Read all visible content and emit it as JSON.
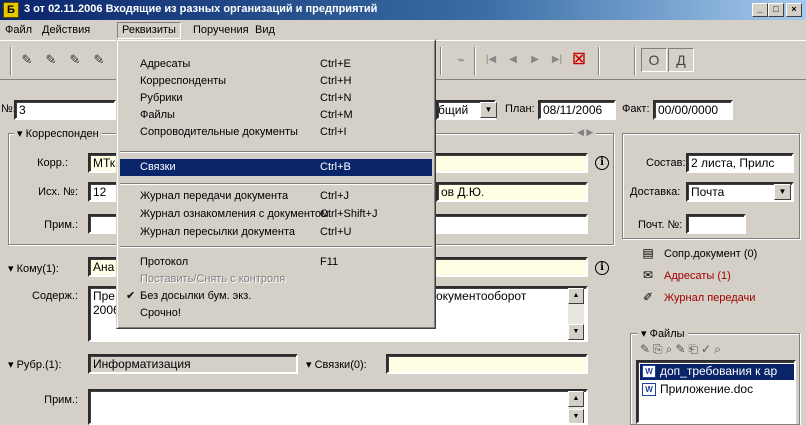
{
  "window": {
    "app_icon": "Б",
    "title": "3 от 02.11.2006 Входящие из разных организаций и предприятий",
    "controls": {
      "minimize": "_",
      "maximize": "□",
      "close": "×"
    }
  },
  "menubar": [
    "Файл",
    "Действия",
    "Реквизиты",
    "Поручения",
    "Вид"
  ],
  "toolbar": {
    "box1": "О",
    "box2": "Д"
  },
  "dropdown": {
    "group1": [
      {
        "label": "Адресаты",
        "shortcut": "Ctrl+E"
      },
      {
        "label": "Корреспонденты",
        "shortcut": "Ctrl+H"
      },
      {
        "label": "Рубрики",
        "shortcut": "Ctrl+N"
      },
      {
        "label": "Файлы",
        "shortcut": "Ctrl+M"
      },
      {
        "label": "Сопроводительные документы",
        "shortcut": "Ctrl+I"
      }
    ],
    "highlight": {
      "label": "Связки",
      "shortcut": "Ctrl+B"
    },
    "group2": [
      {
        "label": "Журнал передачи документа",
        "shortcut": "Ctrl+J"
      },
      {
        "label": "Журнал ознакомления с документом",
        "shortcut": "Ctrl+Shift+J"
      },
      {
        "label": "Журнал пересылки документа",
        "shortcut": "Ctrl+U"
      }
    ],
    "group3": [
      {
        "label": "Протокол",
        "shortcut": "F11"
      },
      {
        "label": "Поставить/Снять с контроля",
        "shortcut": ""
      },
      {
        "label": "Без досылки бум. экз.",
        "shortcut": ""
      },
      {
        "label": "Срочно!",
        "shortcut": ""
      }
    ],
    "check_mark": "✔"
  },
  "form": {
    "num_label": "№:",
    "num_value": "3",
    "access_value": "бщий",
    "plan_label": "План:",
    "plan_value": "08/11/2006",
    "fact_label": "Факт:",
    "fact_value": "00/00/0000",
    "corr_group": "Корреспонден",
    "korr_label": "Корр.:",
    "korr_value": "МТк",
    "ish_label": "Исх. №:",
    "ish_value": "12",
    "signer_value": "ов Д.Ю.",
    "prim_label": "Прим.:",
    "komu_label": "Кому(1):",
    "komu_value": "Ана",
    "soderzh_label": "Содерж.:",
    "soderzh_line1": "Пре",
    "soderzh_line2": "2006",
    "soderzh_tail": "окументооборот",
    "rubr_label": "Рубр.(1):",
    "rubr_value": "Информатизация",
    "svyazki_label": "Связки(0):",
    "prim2_label": "Прим.:"
  },
  "right_panel": {
    "sostav_label": "Состав:",
    "sostav_value": "2 листа, Прилс",
    "dostavka_label": "Доставка:",
    "dostavka_value": "Почта",
    "pocht_label": "Почт. №:",
    "links": [
      {
        "label": "Сопр.документ (0)",
        "color": "#000000"
      },
      {
        "label": "Адресаты (1)",
        "color": "#a00000"
      },
      {
        "label": "Журнал передачи",
        "color": "#a00000"
      }
    ],
    "files_label": "Файлы",
    "files": [
      "доп_требования к ар",
      "Приложение.doc"
    ]
  }
}
